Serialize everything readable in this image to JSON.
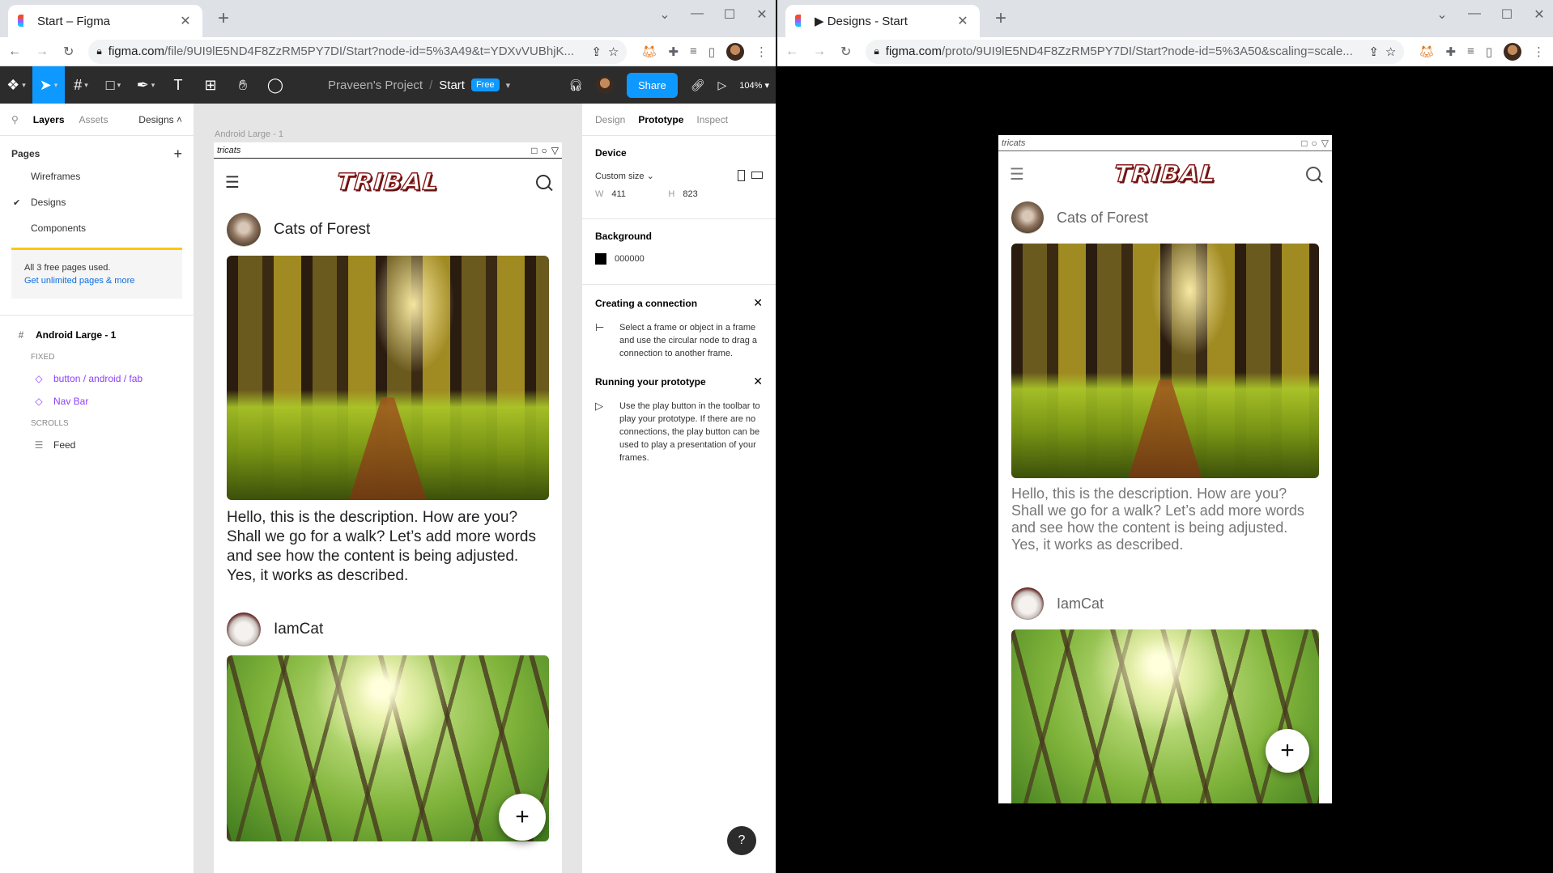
{
  "left_window": {
    "tab_title": "Start – Figma",
    "url_host": "figma.com",
    "url_path": "/file/9UI9lE5ND4F8ZzRM5PY7DI/Start?node-id=5%3A49&t=YDXvVUBhjK...",
    "figma": {
      "project": "Praveen's Project",
      "file": "Start",
      "plan_badge": "Free",
      "share_label": "Share",
      "zoom": "104%"
    },
    "left_panel": {
      "tabs": [
        "Layers",
        "Assets"
      ],
      "page_dropdown": "Designs",
      "pages_header": "Pages",
      "pages": [
        "Wireframes",
        "Designs",
        "Components"
      ],
      "note_text": "All 3 free pages used.",
      "note_link": "Get unlimited pages & more",
      "frame_name": "Android Large - 1",
      "fixed_label": "FIXED",
      "fixed_layers": [
        "button / android / fab",
        "Nav Bar"
      ],
      "scrolls_label": "SCROLLS",
      "scroll_layers": [
        "Feed"
      ]
    },
    "canvas": {
      "frame_label": "Android Large - 1"
    },
    "right_panel": {
      "tabs": [
        "Design",
        "Prototype",
        "Inspect"
      ],
      "device_title": "Device",
      "device_size": "Custom size",
      "w_label": "W",
      "w_value": "411",
      "h_label": "H",
      "h_value": "823",
      "background_title": "Background",
      "background_value": "000000",
      "tip1_title": "Creating a connection",
      "tip1_body": "Select a frame or object in a frame and use the circular node to drag a connection to another frame.",
      "tip2_title": "Running your prototype",
      "tip2_body": "Use the play button in the toolbar to play your prototype. If there are no connections, the play button can be used to play a presentation of your frames.",
      "help": "?"
    }
  },
  "right_window": {
    "tab_title": "▶ Designs - Start",
    "url_host": "figma.com",
    "url_path": "/proto/9UI9lE5ND4F8ZzRM5PY7DI/Start?node-id=5%3A50&scaling=scale..."
  },
  "app": {
    "status_label": "tricats",
    "logo": "TRIBAL",
    "posts": [
      {
        "name": "Cats of Forest",
        "description": "Hello, this is the description. How are you? Shall we go for a walk? Let’s add more words and see how the content is being adjusted. Yes, it works as described."
      },
      {
        "name": "IamCat"
      }
    ],
    "fab_label": "+"
  },
  "colors": {
    "figma_accent": "#0d99ff",
    "toolbar_bg": "#2c2c2c",
    "warning_bar": "#ffc700",
    "component_purple": "#8b3ffa",
    "link_blue": "#0d6ee0"
  }
}
